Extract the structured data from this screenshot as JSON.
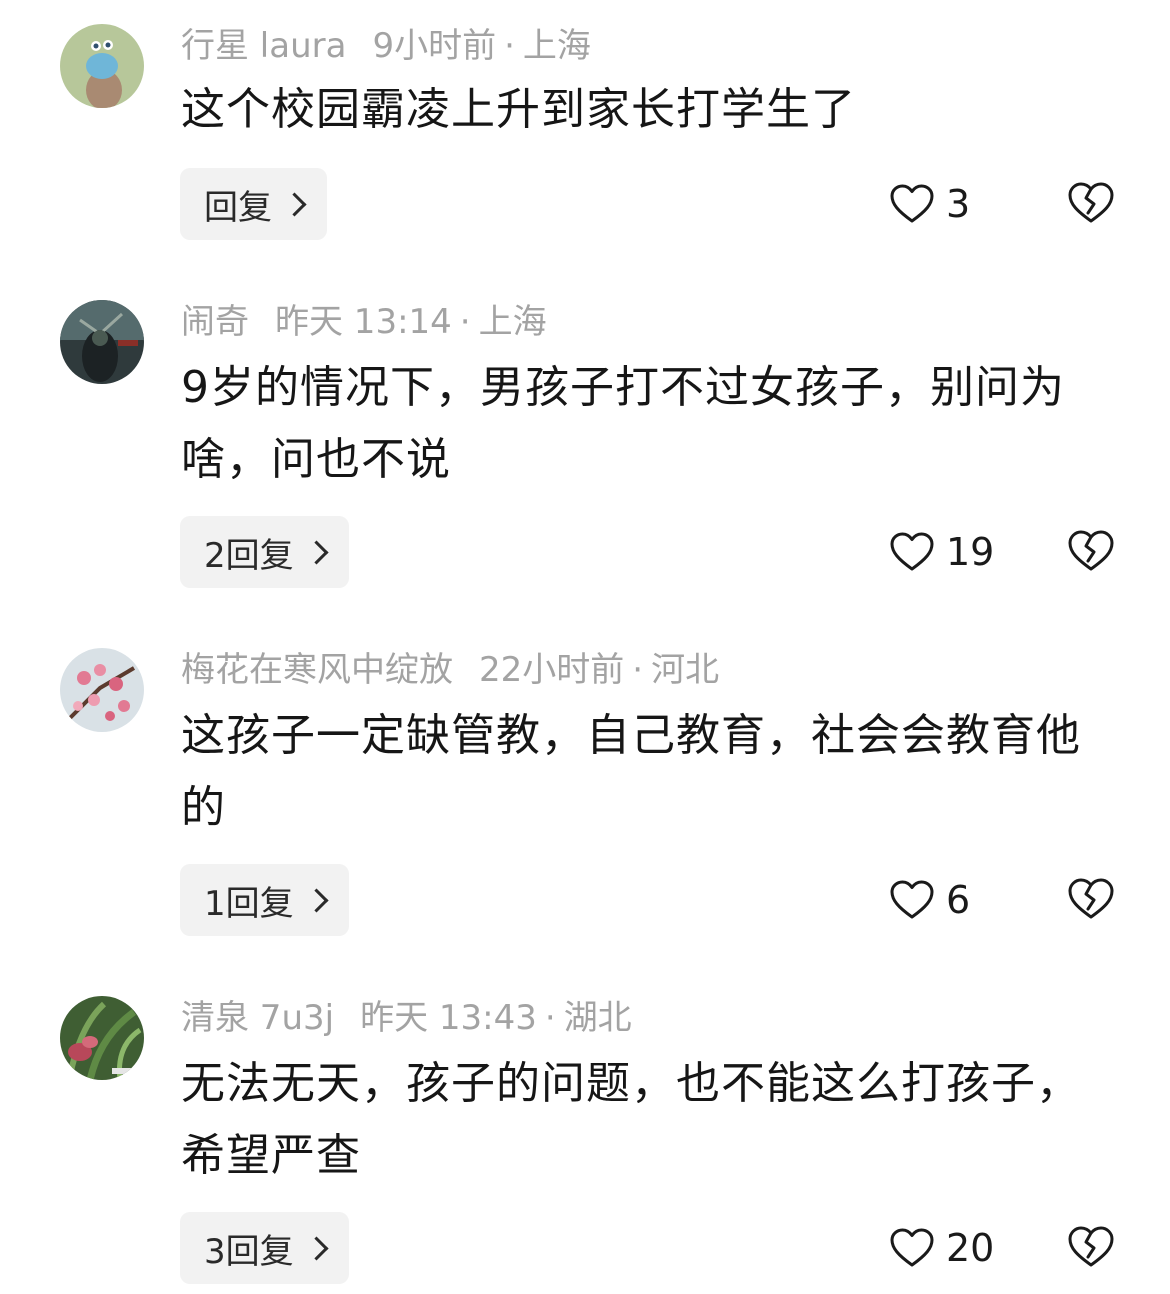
{
  "comments": [
    {
      "username": "行星 laura",
      "time": "9小时前",
      "separator": "·",
      "location": "上海",
      "text": "这个校园霸凌上升到家长打学生了",
      "reply_label": "回复",
      "like_count": "3"
    },
    {
      "username": "闹奇",
      "time": "昨天 13:14",
      "separator": "·",
      "location": "上海",
      "text": "9岁的情况下，男孩子打不过女孩子，别问为啥，问也不说",
      "reply_label": "2回复",
      "like_count": "19"
    },
    {
      "username": "梅花在寒风中绽放",
      "time": "22小时前",
      "separator": "·",
      "location": "河北",
      "text": "这孩子一定缺管教，自己教育，社会会教育他的",
      "reply_label": "1回复",
      "like_count": "6"
    },
    {
      "username": "清泉 7u3j",
      "time": "昨天 13:43",
      "separator": "·",
      "location": "湖北",
      "text": "无法无天，孩子的问题，也不能这么打孩子，希望严查",
      "reply_label": "3回复",
      "like_count": "20"
    }
  ],
  "icons": {
    "like": "heart-outline-icon",
    "dislike": "broken-heart-icon",
    "reply_arrow": "chevron-right-icon"
  },
  "colors": {
    "meta_text": "#a3a3a3",
    "body_text": "#161616",
    "reply_bg": "#f2f2f2"
  }
}
